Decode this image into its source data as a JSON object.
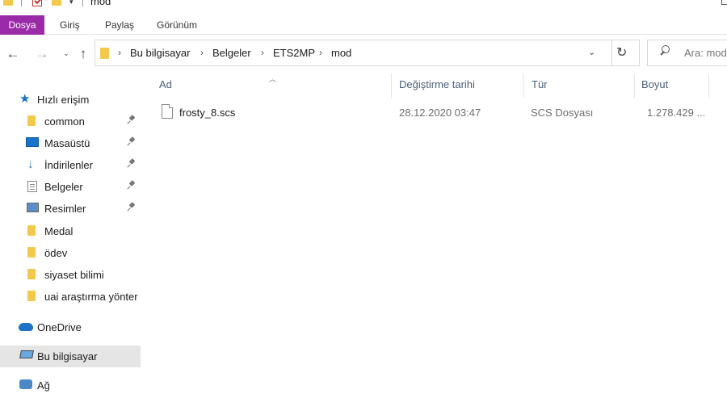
{
  "window": {
    "title": "mod"
  },
  "ribbon": {
    "tabs": [
      "Dosya",
      "Giriş",
      "Paylaş",
      "Görünüm"
    ]
  },
  "address": {
    "breadcrumb": [
      "Bu bilgisayar",
      "Belgeler",
      "ETS2MP",
      "mod"
    ]
  },
  "search": {
    "placeholder": "Ara: mod"
  },
  "sidebar": {
    "quick_access": "Hızlı erişim",
    "items": [
      {
        "label": "common",
        "icon": "folder-icon",
        "pinned": true
      },
      {
        "label": "Masaüstü",
        "icon": "desktop-icon",
        "pinned": true
      },
      {
        "label": "İndirilenler",
        "icon": "download-icon",
        "pinned": true
      },
      {
        "label": "Belgeler",
        "icon": "documents-icon",
        "pinned": true
      },
      {
        "label": "Resimler",
        "icon": "pictures-icon",
        "pinned": true
      },
      {
        "label": "Medal",
        "icon": "folder-icon",
        "pinned": false
      },
      {
        "label": "ödev",
        "icon": "folder-icon",
        "pinned": false
      },
      {
        "label": "siyaset bilimi",
        "icon": "folder-icon",
        "pinned": false
      },
      {
        "label": "uai araştırma yönter",
        "icon": "folder-icon",
        "pinned": false
      }
    ],
    "onedrive": "OneDrive",
    "this_pc": "Bu bilgisayar",
    "network": "Ağ"
  },
  "columns": {
    "name": "Ad",
    "modified": "Değiştirme tarihi",
    "type": "Tür",
    "size": "Boyut"
  },
  "files": [
    {
      "name": "frosty_8.scs",
      "modified": "28.12.2020 03:47",
      "type": "SCS Dosyası",
      "size": "1.278.429 ..."
    }
  ],
  "colors": {
    "file_tab": "#9a2aa7",
    "selected_nav": "#e5e5e5",
    "header_text": "#4c607a"
  }
}
